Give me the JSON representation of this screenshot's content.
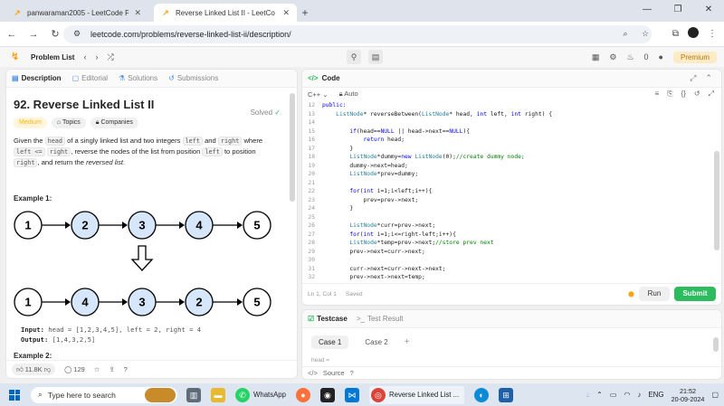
{
  "browser": {
    "tabs": [
      {
        "title": "panwaraman2005 - LeetCode P",
        "active": false
      },
      {
        "title": "Reverse Linked List II - LeetCo",
        "active": true
      }
    ],
    "url": "leetcode.com/problems/reverse-linked-list-ii/description/"
  },
  "navbar": {
    "problem_list": "Problem List",
    "coins": "0",
    "premium": "Premium"
  },
  "left_panel": {
    "tabs": [
      "Description",
      "Editorial",
      "Solutions",
      "Submissions"
    ],
    "title": "92. Reverse Linked List II",
    "solved": "Solved",
    "tags": [
      "Medium",
      "Topics",
      "Companies"
    ],
    "desc": {
      "p1": "Given the ",
      "c1": "head",
      "p2": " of a singly linked list and two integers ",
      "c2": "left",
      "p3": " and ",
      "c3": "right",
      "p4": " where ",
      "c4": "left <=",
      "c5": "right",
      "p5": ", reverse the nodes of the list from position ",
      "c6": "left",
      "p6": " to position ",
      "c7": "right",
      "p7": ", and return the ",
      "em": "reversed list",
      "p8": "."
    },
    "example1": "Example 1:",
    "example2": "Example 2:",
    "list_before": [
      "1",
      "2",
      "3",
      "4",
      "5"
    ],
    "list_after": [
      "1",
      "4",
      "3",
      "2",
      "5"
    ],
    "highlighted_indices": [
      1,
      2,
      3
    ],
    "input_label": "Input:",
    "input_value": "head = [1,2,3,4,5], left = 2, right = 4",
    "output_label": "Output:",
    "output_value": "[1,4,3,2,5]",
    "likes": "11.8K",
    "comments": "129"
  },
  "code_panel": {
    "title": "Code",
    "language": "C++",
    "mode": "Auto",
    "lines": [
      {
        "n": "12",
        "segs": [
          [
            "kw",
            "public:"
          ]
        ]
      },
      {
        "n": "13",
        "segs": [
          [
            "ty",
            "    ListNode"
          ],
          [
            "tx",
            "* reverseBetween("
          ],
          [
            "ty",
            "ListNode"
          ],
          [
            "tx",
            "* head, "
          ],
          [
            "kw",
            "int"
          ],
          [
            "tx",
            " left, "
          ],
          [
            "kw",
            "int"
          ],
          [
            "tx",
            " right) {"
          ]
        ]
      },
      {
        "n": "14",
        "segs": [
          [
            "tx",
            ""
          ]
        ]
      },
      {
        "n": "15",
        "segs": [
          [
            "kw",
            "        if"
          ],
          [
            "tx",
            "(head=="
          ],
          [
            "kw",
            "NULL"
          ],
          [
            "tx",
            " || head->next=="
          ],
          [
            "kw",
            "NULL"
          ],
          [
            "tx",
            "){"
          ]
        ]
      },
      {
        "n": "16",
        "segs": [
          [
            "kw",
            "            return"
          ],
          [
            "tx",
            " head;"
          ]
        ]
      },
      {
        "n": "17",
        "segs": [
          [
            "tx",
            "        }"
          ]
        ]
      },
      {
        "n": "18",
        "segs": [
          [
            "ty",
            "        ListNode"
          ],
          [
            "tx",
            "*dummy="
          ],
          [
            "kw",
            "new"
          ],
          [
            "ty",
            " ListNode"
          ],
          [
            "tx",
            "(0);"
          ],
          [
            "cm",
            "//create dummy node;"
          ]
        ]
      },
      {
        "n": "19",
        "segs": [
          [
            "tx",
            "        dummy->next=head;"
          ]
        ]
      },
      {
        "n": "20",
        "segs": [
          [
            "ty",
            "        ListNode"
          ],
          [
            "tx",
            "*prev=dummy;"
          ]
        ]
      },
      {
        "n": "21",
        "segs": [
          [
            "tx",
            ""
          ]
        ]
      },
      {
        "n": "22",
        "segs": [
          [
            "kw",
            "        for"
          ],
          [
            "tx",
            "("
          ],
          [
            "kw",
            "int"
          ],
          [
            "tx",
            " i=1;i<left;i++){"
          ]
        ]
      },
      {
        "n": "23",
        "segs": [
          [
            "tx",
            "            prev=prev->next;"
          ]
        ]
      },
      {
        "n": "24",
        "segs": [
          [
            "tx",
            "        }"
          ]
        ]
      },
      {
        "n": "25",
        "segs": [
          [
            "tx",
            ""
          ]
        ]
      },
      {
        "n": "26",
        "segs": [
          [
            "ty",
            "        ListNode"
          ],
          [
            "tx",
            "*curr=prev->next;"
          ]
        ]
      },
      {
        "n": "27",
        "segs": [
          [
            "kw",
            "        for"
          ],
          [
            "tx",
            "("
          ],
          [
            "kw",
            "int"
          ],
          [
            "tx",
            " i=1;i<=right-left;i++){"
          ]
        ]
      },
      {
        "n": "28",
        "segs": [
          [
            "ty",
            "        ListNode"
          ],
          [
            "tx",
            "*temp=prev->next;"
          ],
          [
            "cm",
            "//store prev next"
          ]
        ]
      },
      {
        "n": "29",
        "segs": [
          [
            "tx",
            "        prev->next=curr->next;"
          ]
        ]
      },
      {
        "n": "30",
        "segs": [
          [
            "tx",
            ""
          ]
        ]
      },
      {
        "n": "31",
        "segs": [
          [
            "tx",
            "        curr->next=curr->next->next;"
          ]
        ]
      },
      {
        "n": "32",
        "segs": [
          [
            "tx",
            "        prev->next->next=temp;"
          ]
        ]
      },
      {
        "n": "33",
        "segs": [
          [
            "tx",
            "        }"
          ]
        ]
      }
    ],
    "cursor": "Ln 1, Col 1",
    "saved": "Saved",
    "run": "Run",
    "submit": "Submit"
  },
  "test_panel": {
    "tab_testcase": "Testcase",
    "tab_result": "Test Result",
    "cases": [
      "Case 1",
      "Case 2"
    ],
    "partial": "head =",
    "source": "Source"
  },
  "taskbar": {
    "search_placeholder": "Type here to search",
    "whatsapp": "WhatsApp",
    "chrome_task": "Reverse Linked List ...",
    "lang": "ENG",
    "time": "21:52",
    "date": "20-09-2024"
  },
  "colors": {
    "node_highlight": "#d6e7fb",
    "accent_green": "#2cbb5d",
    "accent_orange": "#ffa116"
  }
}
